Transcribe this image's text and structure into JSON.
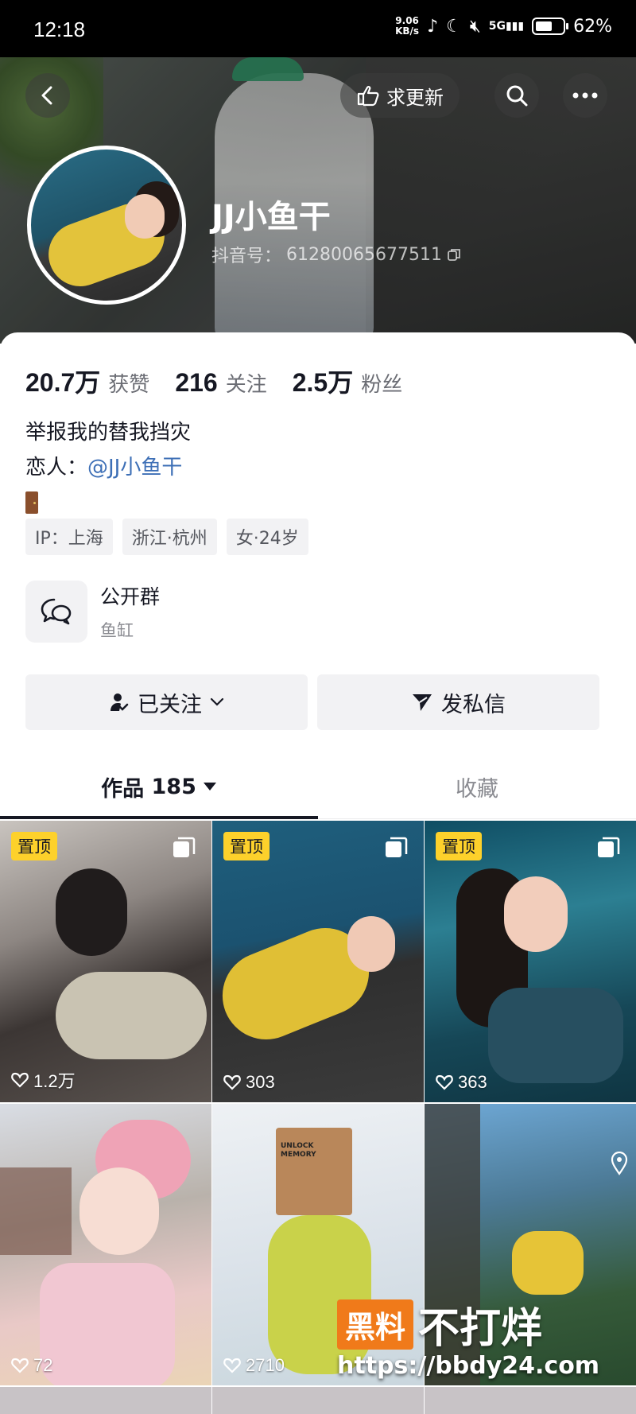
{
  "status_bar": {
    "time": "12:18",
    "net_speed_value": "9.06",
    "net_speed_unit": "KB/s",
    "network": "5G",
    "battery": "62%",
    "battery_level": 0.62
  },
  "header": {
    "update_label": "求更新",
    "name": "JJ小鱼干",
    "id_label": "抖音号：",
    "id_value": "61280065677511"
  },
  "stats": [
    {
      "value": "20.7万",
      "label": "获赞"
    },
    {
      "value": "216",
      "label": "关注"
    },
    {
      "value": "2.5万",
      "label": "粉丝"
    }
  ],
  "bio": {
    "line1": "举报我的替我挡灾",
    "lover_label": "恋人：",
    "lover_link": "@JJ小鱼干"
  },
  "tags": [
    "IP：上海",
    "浙江·杭州",
    "女·24岁"
  ],
  "group": {
    "title": "公开群",
    "subtitle": "鱼缸"
  },
  "actions": {
    "follow": "已关注",
    "message": "发私信"
  },
  "tabs": {
    "works_label": "作品",
    "works_count": "185",
    "favorites": "收藏"
  },
  "videos": [
    {
      "pinned": true,
      "pin_label": "置顶",
      "likes": "1.2万"
    },
    {
      "pinned": true,
      "pin_label": "置顶",
      "likes": "303"
    },
    {
      "pinned": true,
      "pin_label": "置顶",
      "likes": "363"
    },
    {
      "pinned": false,
      "likes": "72"
    },
    {
      "pinned": false,
      "likes": "2710",
      "bag_text": "UNLOCK MEMORY"
    },
    {
      "pinned": false,
      "likes": ""
    }
  ],
  "watermark": {
    "brand_box": "黑料",
    "brand_text": "不打烊",
    "url": "https://bbdy24.com"
  },
  "colors": {
    "accent_link": "#3d6fb6",
    "pin_badge": "#fdd12b",
    "watermark_orange": "#f07a1a"
  }
}
